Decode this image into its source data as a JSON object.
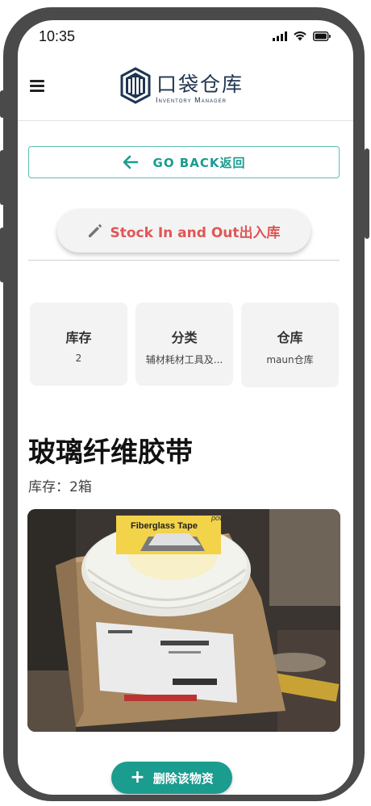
{
  "status_bar": {
    "time": "10:35",
    "icons": [
      "signal-icon",
      "wifi-icon",
      "battery-icon"
    ]
  },
  "app_bar": {
    "menu_icon": "menu-icon",
    "logo_title": "口袋仓库",
    "logo_subtitle": "Inventory Manager"
  },
  "go_back": {
    "label": "GO BACK返回",
    "icon": "arrow-left-icon"
  },
  "stock_button": {
    "label": "Stock In and Out出入库",
    "icon": "pencil-icon"
  },
  "cards": [
    {
      "title": "库存",
      "value": "2"
    },
    {
      "title": "分类",
      "value": "辅材耗材工具及..."
    },
    {
      "title": "仓库",
      "value": "maun仓库"
    }
  ],
  "item": {
    "name": "玻璃纤维胶带",
    "stock_text": "库存：2箱",
    "photo_label": "Fiberglass Tape",
    "photo_brand": "power"
  },
  "delete_button": {
    "label": "删除该物资",
    "icon": "plus-icon"
  },
  "colors": {
    "accent": "#1a9c8f",
    "stock_button_text": "#e05656",
    "logo": "#1f3550",
    "device_frame": "#4a4a4a"
  }
}
